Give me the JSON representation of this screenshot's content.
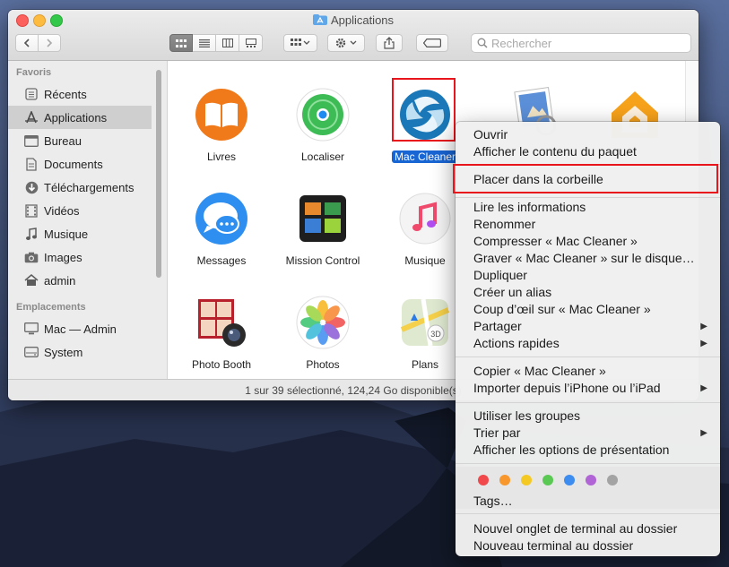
{
  "window": {
    "title": "Applications",
    "search_placeholder": "Rechercher",
    "status": "1 sur 39 sélectionné, 124,24 Go disponible(s)"
  },
  "sidebar": {
    "favorites_header": "Favoris",
    "favorites": [
      {
        "label": "Récents",
        "icon": "recents-icon"
      },
      {
        "label": "Applications",
        "icon": "applications-icon",
        "selected": true
      },
      {
        "label": "Bureau",
        "icon": "desktop-icon"
      },
      {
        "label": "Documents",
        "icon": "documents-icon"
      },
      {
        "label": "Téléchargements",
        "icon": "downloads-icon"
      },
      {
        "label": "Vidéos",
        "icon": "videos-icon"
      },
      {
        "label": "Musique",
        "icon": "music-icon"
      },
      {
        "label": "Images",
        "icon": "images-icon"
      },
      {
        "label": "admin",
        "icon": "home-icon"
      }
    ],
    "locations_header": "Emplacements",
    "locations": [
      {
        "label": "Mac — Admin",
        "icon": "computer-icon"
      },
      {
        "label": "System",
        "icon": "disk-icon"
      }
    ]
  },
  "apps": [
    {
      "label": "Livres"
    },
    {
      "label": "Localiser"
    },
    {
      "label": "Mac Cleaner",
      "selected": true
    },
    {
      "label": "Messages"
    },
    {
      "label": "Mission Control"
    },
    {
      "label": "Musique"
    },
    {
      "label": "Photo Booth"
    },
    {
      "label": "Photos"
    },
    {
      "label": "Plans"
    }
  ],
  "context_menu": {
    "items": [
      "Ouvrir",
      "Afficher le contenu du paquet",
      "Placer dans la corbeille",
      "Lire les informations",
      "Renommer",
      "Compresser « Mac Cleaner »",
      "Graver « Mac Cleaner » sur le disque…",
      "Dupliquer",
      "Créer un alias",
      "Coup d’œil sur « Mac Cleaner »",
      "Partager",
      "Actions rapides",
      "Copier « Mac Cleaner »",
      "Importer depuis l’iPhone ou l’iPad",
      "Utiliser les groupes",
      "Trier par",
      "Afficher les options de présentation",
      "Tags…",
      "Nouvel onglet de terminal au dossier",
      "Nouveau terminal au dossier"
    ],
    "tag_colors": [
      "#f0484b",
      "#f7972c",
      "#f5c924",
      "#5ac954",
      "#3d8cf0",
      "#b064d6",
      "#a3a3a3"
    ]
  },
  "highlight_color": "#e8161c",
  "selection_color": "#1865d4"
}
